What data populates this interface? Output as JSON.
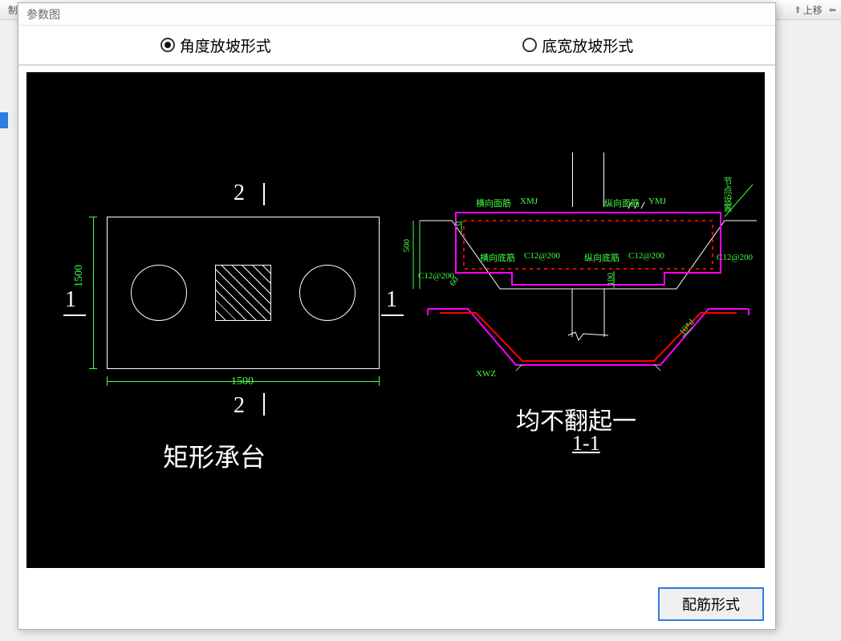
{
  "modal": {
    "title": "参数图"
  },
  "toolbar": {
    "left_item": "制",
    "right_item": "上移"
  },
  "radio": {
    "opt_angle": "角度放坡形式",
    "opt_width": "底宽放坡形式"
  },
  "left_cad": {
    "title": "矩形承台",
    "width_dim": "1500",
    "height_dim": "1500",
    "sect_1": "1",
    "sect_2": "2"
  },
  "right_cad": {
    "title": "均不翻起一",
    "subtitle": "1-1",
    "label_hxmj": "横向面筋",
    "label_xmj": "XMJ",
    "label_zxmj": "纵向面筋",
    "label_ymj": "YMJ",
    "label_hxdj": "横向底筋",
    "label_c12_200_a": "C12@200",
    "label_zxdj": "纵向底筋",
    "label_c12_200_b": "C12@200",
    "label_c12_200_c": "C12@200",
    "label_c12_200_d": "C12@200",
    "label_leader_r": "节点设置",
    "dim_500": "500",
    "dim_100": "100",
    "dim_0": "0",
    "dim_60": "60",
    "label_xwz": "XWZ",
    "label_10d": "10*d"
  },
  "footer": {
    "btn_label": "配筋形式"
  }
}
